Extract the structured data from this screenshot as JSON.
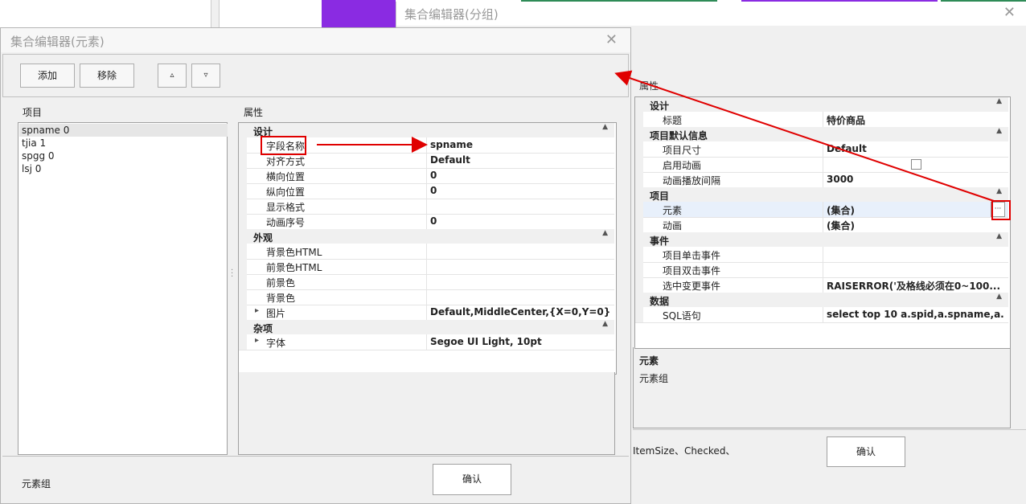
{
  "element_editor": {
    "title": "集合编辑器(元素)",
    "buttons": {
      "add": "添加",
      "remove": "移除",
      "up": "▵",
      "down": "▿"
    },
    "items_label": "项目",
    "props_label": "属性",
    "items": [
      "spname 0",
      "tjia 1",
      "spgg 0",
      "lsj 0"
    ],
    "categories": [
      {
        "name": "设计",
        "rows": [
          {
            "name": "字段名称",
            "value": "spname"
          },
          {
            "name": "对齐方式",
            "value": "Default"
          },
          {
            "name": "横向位置",
            "value": "0"
          },
          {
            "name": "纵向位置",
            "value": "0"
          },
          {
            "name": "显示格式",
            "value": ""
          },
          {
            "name": "动画序号",
            "value": "0"
          }
        ]
      },
      {
        "name": "外观",
        "rows": [
          {
            "name": "背景色HTML",
            "value": ""
          },
          {
            "name": "前景色HTML",
            "value": ""
          },
          {
            "name": "前景色",
            "value": ""
          },
          {
            "name": "背景色",
            "value": ""
          },
          {
            "name": "图片",
            "value": "Default,MiddleCenter,{X=0,Y=0},..."
          }
        ]
      },
      {
        "name": "杂项",
        "rows": [
          {
            "name": "字体",
            "value": "Segoe UI Light, 10pt"
          }
        ]
      }
    ],
    "bottom_text": "元素组",
    "ok": "确认"
  },
  "group_editor": {
    "title": "集合编辑器(分组)",
    "props_label": "属性",
    "categories": [
      {
        "name": "设计",
        "rows": [
          {
            "name": "标题",
            "value": "特价商品"
          }
        ]
      },
      {
        "name": "项目默认信息",
        "rows": [
          {
            "name": "项目尺寸",
            "value": "Default"
          },
          {
            "name": "启用动画",
            "value": ""
          },
          {
            "name": "动画播放间隔",
            "value": "3000"
          }
        ]
      },
      {
        "name": "项目",
        "rows": [
          {
            "name": "元素",
            "value": "(集合)"
          },
          {
            "name": "动画",
            "value": "(集合)"
          }
        ]
      },
      {
        "name": "事件",
        "rows": [
          {
            "name": "项目单击事件",
            "value": ""
          },
          {
            "name": "项目双击事件",
            "value": ""
          },
          {
            "name": "选中变更事件",
            "value": "RAISERROR('及格线必须在0~100..."
          }
        ]
      },
      {
        "name": "数据",
        "rows": [
          {
            "name": "SQL语句",
            "value": "select top 10 a.spid,a.spname,a.sp..."
          }
        ]
      }
    ],
    "desc_title": "元素",
    "desc_text": "元素组",
    "bottom_text": "ItemSize、Checked、",
    "ok": "确认",
    "ellipsis": "···"
  },
  "colors": {
    "annotation": "#e00000",
    "accent_purple": "#8a2be2",
    "accent_green": "#2e8b57"
  }
}
